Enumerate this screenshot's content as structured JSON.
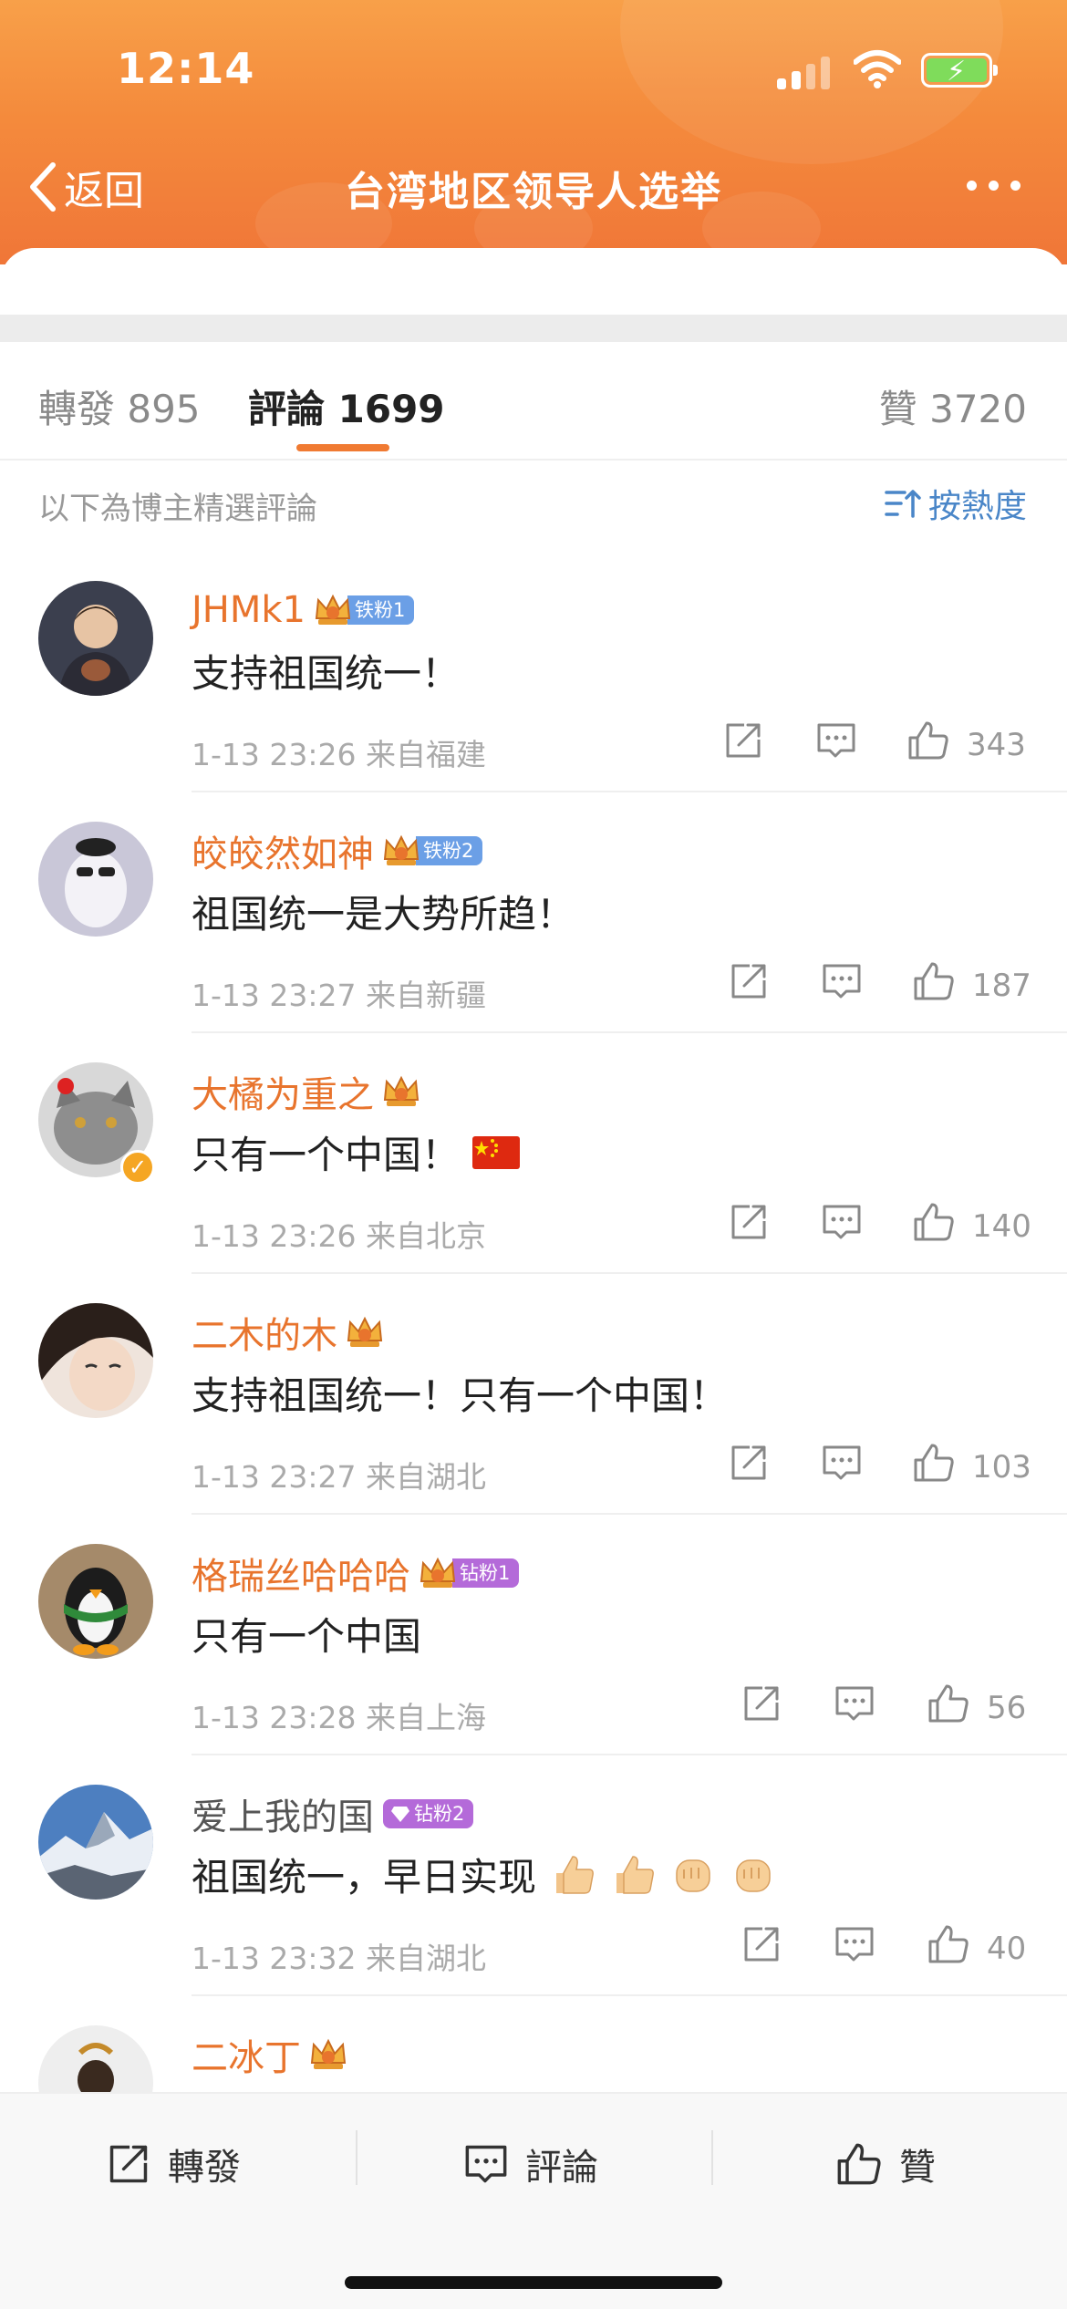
{
  "status_bar": {
    "time": "12:14"
  },
  "nav": {
    "back_label": "返回",
    "title": "台湾地区领导人选举"
  },
  "tabs": {
    "repost": "轉發 895",
    "comment": "評論 1699",
    "like": "贊 3720"
  },
  "filter": {
    "note": "以下為博主精選評論",
    "sort_label": "按熱度"
  },
  "comments": [
    {
      "name": "JHMk1",
      "badge": "铁粉1",
      "text": "支持祖国统一！",
      "meta": "1-13 23:26  来自福建",
      "likes": "343"
    },
    {
      "name": "皎皎然如神",
      "badge": "铁粉2",
      "text": "祖国统一是大势所趋！",
      "meta": "1-13 23:27  来自新疆",
      "likes": "187"
    },
    {
      "name": "大橘为重之",
      "badge": "",
      "text": "只有一个中国！",
      "meta": "1-13 23:26  来自北京",
      "likes": "140"
    },
    {
      "name": "二木的木",
      "badge": "",
      "text": "支持祖国统一！只有一个中国！",
      "meta": "1-13 23:27  来自湖北",
      "likes": "103"
    },
    {
      "name": "格瑞丝哈哈哈",
      "badge": "钻粉1",
      "text": "只有一个中国",
      "meta": "1-13 23:28  来自上海",
      "likes": "56"
    },
    {
      "name": "爱上我的国",
      "badge": "钻粉2",
      "text": "祖国统一，早日实现",
      "meta": "1-13 23:32  来自湖北",
      "likes": "40"
    },
    {
      "name": "二冰丁",
      "badge": "",
      "text": "",
      "meta": "",
      "likes": ""
    }
  ],
  "bottom_bar": {
    "repost": "轉發",
    "comment": "評論",
    "like": "贊"
  },
  "colors": {
    "accent": "#f07a32",
    "username": "#e8742d",
    "link_blue": "#4a86c8"
  }
}
